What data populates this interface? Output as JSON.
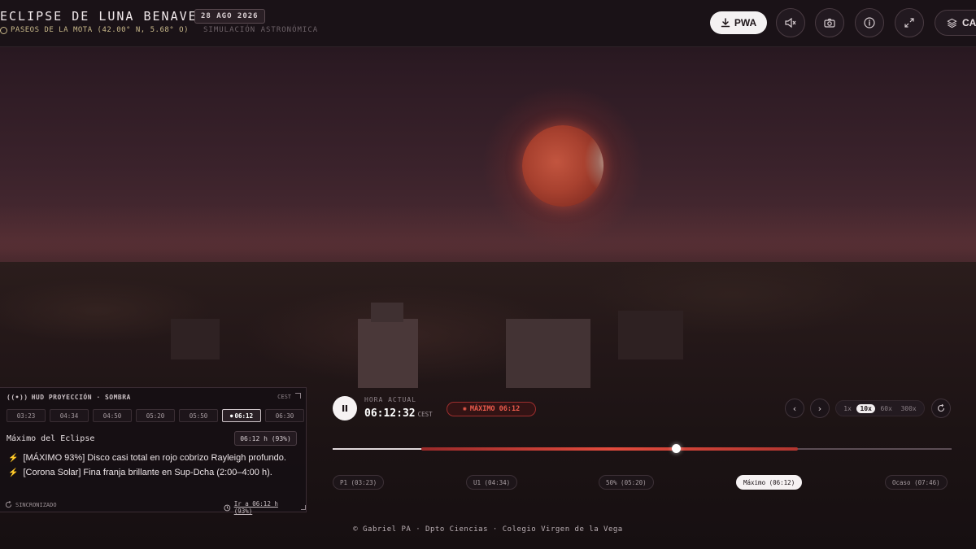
{
  "header": {
    "title": "ECLIPSE DE LUNA BENAVENTE",
    "date": "28 AGO 2026",
    "location": "PASEOS DE LA MOTA (42.00° N, 5.68° O)",
    "subtitle": "SIMULACIÓN ASTRONÓMICA",
    "pwa_label": "PWA",
    "cap_label": "CAP",
    "icons": [
      "download-icon",
      "mute-icon",
      "camera-icon",
      "info-icon",
      "fullscreen-icon",
      "layers-icon"
    ]
  },
  "hud": {
    "header": "HUD PROYECCIÓN · SOMBRA",
    "timezone": "CEST",
    "times": [
      "03:23",
      "04:34",
      "04:50",
      "05:20",
      "05:50",
      "06:12",
      "06:30"
    ],
    "active_time": "06:12",
    "event_title": "Máximo del Eclipse",
    "event_badge": "06:12 h (93%)",
    "notes": [
      "[MÁXIMO 93%] Disco casi total en rojo cobrizo Rayleigh profundo.",
      "[Corona Solar] Fina franja brillante en Sup-Dcha (2:00–4:00 h)."
    ],
    "sync_label": "SINCRONIZADO",
    "goto_label": "Ir a 06:12 h (93%)"
  },
  "player": {
    "hora_label": "HORA ACTUAL",
    "clock": "06:12:32",
    "clock_tz": "CEST",
    "max_badge": "MÁXIMO 06:12",
    "speeds": [
      "1x",
      "10x",
      "60x",
      "300x"
    ],
    "active_speed": "10x",
    "progress": 0.555,
    "umbra_start": 0.143,
    "umbra_end": 0.751,
    "phases": [
      {
        "label": "P1 (03:23)",
        "active": false
      },
      {
        "label": "U1 (04:34)",
        "active": false
      },
      {
        "label": "50% (05:20)",
        "active": false
      },
      {
        "label": "Máximo (06:12)",
        "active": true
      },
      {
        "label": "Ocaso (07:46)",
        "active": false
      }
    ]
  },
  "footer": "© Gabriel PA · Dpto Ciencias · Colegio Virgen de la Vega",
  "colors": {
    "accent_red": "#e2543e",
    "panel": "#1a1217"
  }
}
